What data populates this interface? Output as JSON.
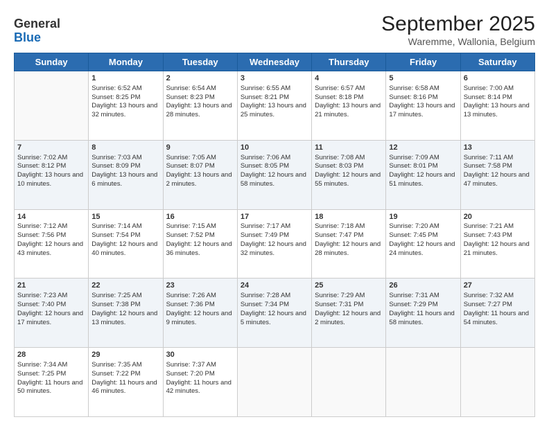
{
  "header": {
    "logo_line1": "General",
    "logo_line2": "Blue",
    "title": "September 2025",
    "subtitle": "Waremme, Wallonia, Belgium"
  },
  "days_of_week": [
    "Sunday",
    "Monday",
    "Tuesday",
    "Wednesday",
    "Thursday",
    "Friday",
    "Saturday"
  ],
  "weeks": [
    {
      "shaded": false,
      "cells": [
        {
          "day": "",
          "sunrise": "",
          "sunset": "",
          "daylight": ""
        },
        {
          "day": "1",
          "sunrise": "Sunrise: 6:52 AM",
          "sunset": "Sunset: 8:25 PM",
          "daylight": "Daylight: 13 hours and 32 minutes."
        },
        {
          "day": "2",
          "sunrise": "Sunrise: 6:54 AM",
          "sunset": "Sunset: 8:23 PM",
          "daylight": "Daylight: 13 hours and 28 minutes."
        },
        {
          "day": "3",
          "sunrise": "Sunrise: 6:55 AM",
          "sunset": "Sunset: 8:21 PM",
          "daylight": "Daylight: 13 hours and 25 minutes."
        },
        {
          "day": "4",
          "sunrise": "Sunrise: 6:57 AM",
          "sunset": "Sunset: 8:18 PM",
          "daylight": "Daylight: 13 hours and 21 minutes."
        },
        {
          "day": "5",
          "sunrise": "Sunrise: 6:58 AM",
          "sunset": "Sunset: 8:16 PM",
          "daylight": "Daylight: 13 hours and 17 minutes."
        },
        {
          "day": "6",
          "sunrise": "Sunrise: 7:00 AM",
          "sunset": "Sunset: 8:14 PM",
          "daylight": "Daylight: 13 hours and 13 minutes."
        }
      ]
    },
    {
      "shaded": true,
      "cells": [
        {
          "day": "7",
          "sunrise": "Sunrise: 7:02 AM",
          "sunset": "Sunset: 8:12 PM",
          "daylight": "Daylight: 13 hours and 10 minutes."
        },
        {
          "day": "8",
          "sunrise": "Sunrise: 7:03 AM",
          "sunset": "Sunset: 8:09 PM",
          "daylight": "Daylight: 13 hours and 6 minutes."
        },
        {
          "day": "9",
          "sunrise": "Sunrise: 7:05 AM",
          "sunset": "Sunset: 8:07 PM",
          "daylight": "Daylight: 13 hours and 2 minutes."
        },
        {
          "day": "10",
          "sunrise": "Sunrise: 7:06 AM",
          "sunset": "Sunset: 8:05 PM",
          "daylight": "Daylight: 12 hours and 58 minutes."
        },
        {
          "day": "11",
          "sunrise": "Sunrise: 7:08 AM",
          "sunset": "Sunset: 8:03 PM",
          "daylight": "Daylight: 12 hours and 55 minutes."
        },
        {
          "day": "12",
          "sunrise": "Sunrise: 7:09 AM",
          "sunset": "Sunset: 8:01 PM",
          "daylight": "Daylight: 12 hours and 51 minutes."
        },
        {
          "day": "13",
          "sunrise": "Sunrise: 7:11 AM",
          "sunset": "Sunset: 7:58 PM",
          "daylight": "Daylight: 12 hours and 47 minutes."
        }
      ]
    },
    {
      "shaded": false,
      "cells": [
        {
          "day": "14",
          "sunrise": "Sunrise: 7:12 AM",
          "sunset": "Sunset: 7:56 PM",
          "daylight": "Daylight: 12 hours and 43 minutes."
        },
        {
          "day": "15",
          "sunrise": "Sunrise: 7:14 AM",
          "sunset": "Sunset: 7:54 PM",
          "daylight": "Daylight: 12 hours and 40 minutes."
        },
        {
          "day": "16",
          "sunrise": "Sunrise: 7:15 AM",
          "sunset": "Sunset: 7:52 PM",
          "daylight": "Daylight: 12 hours and 36 minutes."
        },
        {
          "day": "17",
          "sunrise": "Sunrise: 7:17 AM",
          "sunset": "Sunset: 7:49 PM",
          "daylight": "Daylight: 12 hours and 32 minutes."
        },
        {
          "day": "18",
          "sunrise": "Sunrise: 7:18 AM",
          "sunset": "Sunset: 7:47 PM",
          "daylight": "Daylight: 12 hours and 28 minutes."
        },
        {
          "day": "19",
          "sunrise": "Sunrise: 7:20 AM",
          "sunset": "Sunset: 7:45 PM",
          "daylight": "Daylight: 12 hours and 24 minutes."
        },
        {
          "day": "20",
          "sunrise": "Sunrise: 7:21 AM",
          "sunset": "Sunset: 7:43 PM",
          "daylight": "Daylight: 12 hours and 21 minutes."
        }
      ]
    },
    {
      "shaded": true,
      "cells": [
        {
          "day": "21",
          "sunrise": "Sunrise: 7:23 AM",
          "sunset": "Sunset: 7:40 PM",
          "daylight": "Daylight: 12 hours and 17 minutes."
        },
        {
          "day": "22",
          "sunrise": "Sunrise: 7:25 AM",
          "sunset": "Sunset: 7:38 PM",
          "daylight": "Daylight: 12 hours and 13 minutes."
        },
        {
          "day": "23",
          "sunrise": "Sunrise: 7:26 AM",
          "sunset": "Sunset: 7:36 PM",
          "daylight": "Daylight: 12 hours and 9 minutes."
        },
        {
          "day": "24",
          "sunrise": "Sunrise: 7:28 AM",
          "sunset": "Sunset: 7:34 PM",
          "daylight": "Daylight: 12 hours and 5 minutes."
        },
        {
          "day": "25",
          "sunrise": "Sunrise: 7:29 AM",
          "sunset": "Sunset: 7:31 PM",
          "daylight": "Daylight: 12 hours and 2 minutes."
        },
        {
          "day": "26",
          "sunrise": "Sunrise: 7:31 AM",
          "sunset": "Sunset: 7:29 PM",
          "daylight": "Daylight: 11 hours and 58 minutes."
        },
        {
          "day": "27",
          "sunrise": "Sunrise: 7:32 AM",
          "sunset": "Sunset: 7:27 PM",
          "daylight": "Daylight: 11 hours and 54 minutes."
        }
      ]
    },
    {
      "shaded": false,
      "cells": [
        {
          "day": "28",
          "sunrise": "Sunrise: 7:34 AM",
          "sunset": "Sunset: 7:25 PM",
          "daylight": "Daylight: 11 hours and 50 minutes."
        },
        {
          "day": "29",
          "sunrise": "Sunrise: 7:35 AM",
          "sunset": "Sunset: 7:22 PM",
          "daylight": "Daylight: 11 hours and 46 minutes."
        },
        {
          "day": "30",
          "sunrise": "Sunrise: 7:37 AM",
          "sunset": "Sunset: 7:20 PM",
          "daylight": "Daylight: 11 hours and 42 minutes."
        },
        {
          "day": "",
          "sunrise": "",
          "sunset": "",
          "daylight": ""
        },
        {
          "day": "",
          "sunrise": "",
          "sunset": "",
          "daylight": ""
        },
        {
          "day": "",
          "sunrise": "",
          "sunset": "",
          "daylight": ""
        },
        {
          "day": "",
          "sunrise": "",
          "sunset": "",
          "daylight": ""
        }
      ]
    }
  ]
}
